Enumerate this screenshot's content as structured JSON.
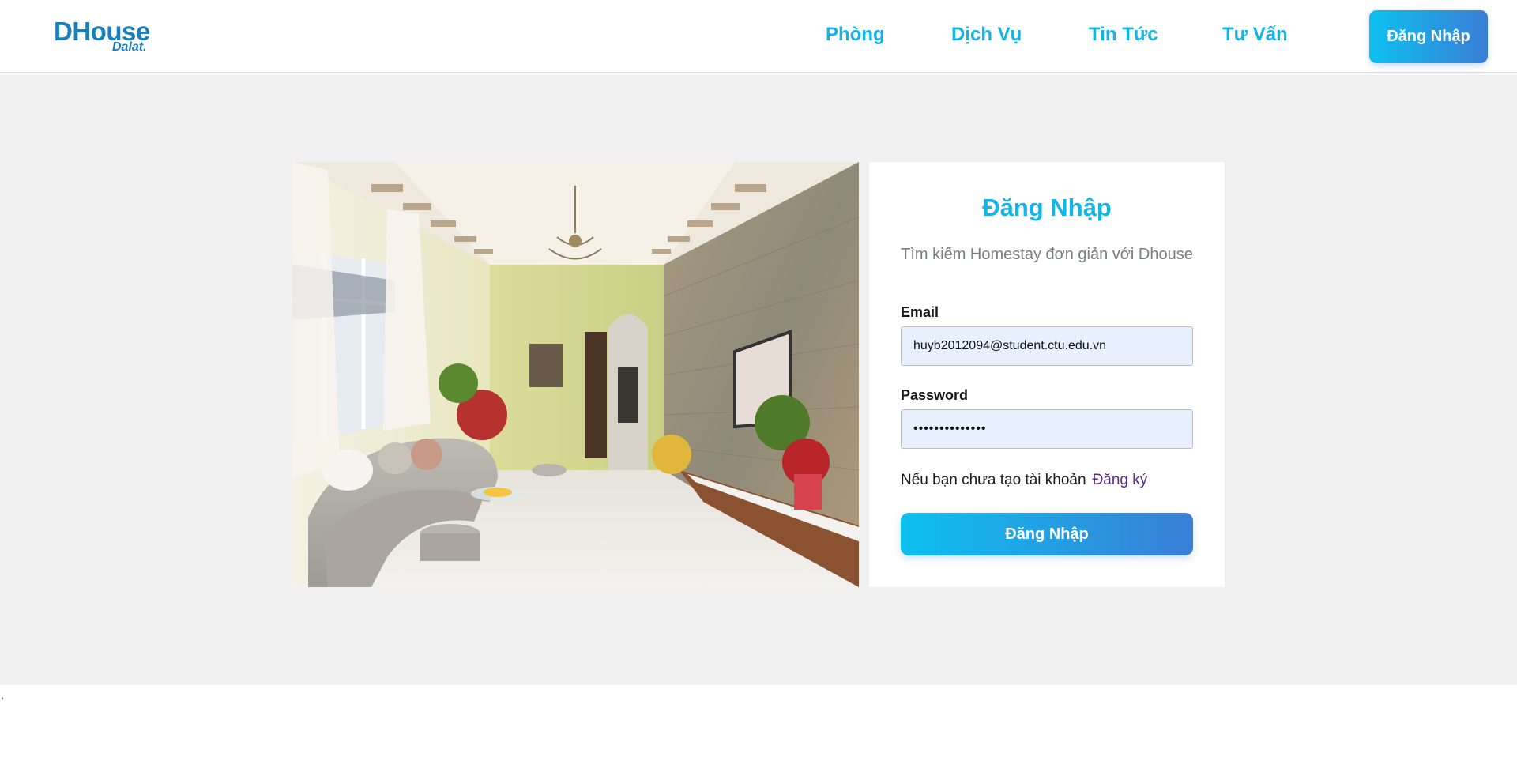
{
  "header": {
    "logo": {
      "main": "DHouse",
      "sub": "Dalat."
    },
    "nav": [
      {
        "label": "Phòng"
      },
      {
        "label": "Dịch Vụ"
      },
      {
        "label": "Tin Tức"
      },
      {
        "label": "Tư Vấn"
      }
    ],
    "login_button": "Đăng Nhập"
  },
  "login_form": {
    "title": "Đăng Nhập",
    "subtitle": "Tìm kiếm Homestay đơn giản với Dhouse",
    "email_label": "Email",
    "email_value": "huyb2012094@student.ctu.edu.vn",
    "password_label": "Password",
    "password_value": "••••••••••••••",
    "register_prompt": "Nếu bạn chưa tạo tài khoản",
    "register_link": "Đăng ký",
    "submit_label": "Đăng Nhập"
  },
  "footer": {
    "mark": ","
  },
  "colors": {
    "brand": "#1a7fb8",
    "accent": "#12b5e4",
    "gradient_start": "#0dc0ef",
    "gradient_end": "#3a7ed6",
    "link": "#5b2a86",
    "background": "#f0f0f0",
    "input_bg": "#e8f0fe"
  }
}
